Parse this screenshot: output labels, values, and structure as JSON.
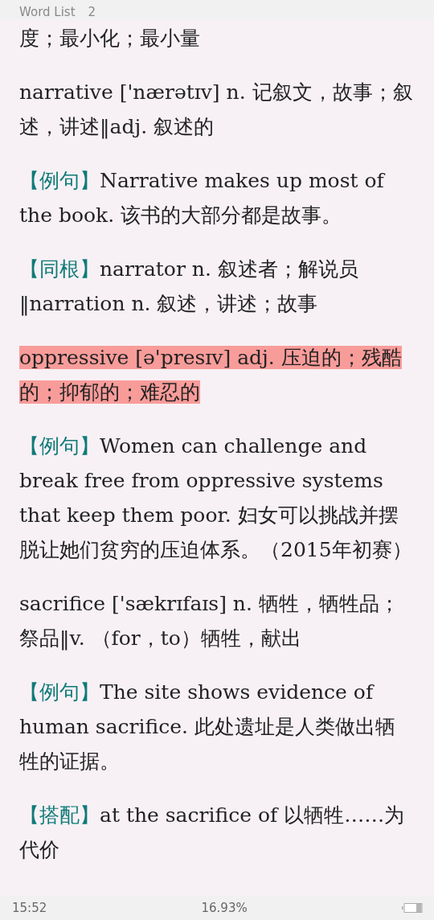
{
  "header": {
    "title": "Word List",
    "number": "2"
  },
  "paragraphs": [
    {
      "text": "度；最小化；最小量",
      "highlighted": false
    },
    {
      "text": "narrative ['nærətɪv] n. 记叙文，故事；叙述，讲述‖adj. 叙述的",
      "highlighted": false
    },
    {
      "tag": "【例句】",
      "text": "Narrative makes up most of the book. 该书的大部分都是故事。",
      "highlighted": false
    },
    {
      "tag": "【同根】",
      "text": "narrator n. 叙述者；解说员‖narration n. 叙述，讲述；故事",
      "highlighted": false
    },
    {
      "text": "oppressive [ə'presɪv] adj. 压迫的；残酷的；抑郁的；难忍的",
      "highlighted": true
    },
    {
      "tag": "【例句】",
      "text": "Women can challenge and break free from oppressive systems that keep them poor. 妇女可以挑战并摆脱让她们贫穷的压迫体系。（2015年初赛）",
      "highlighted": false
    },
    {
      "text": "sacrifice ['sækrɪfaɪs] n. 牺牲，牺牲品；祭品‖v. （for，to）牺牲，献出",
      "highlighted": false
    },
    {
      "tag": "【例句】",
      "text": "The site shows evidence of human sacrifice. 此处遗址是人类做出牺牲的证据。",
      "highlighted": false
    },
    {
      "tag": "【搭配】",
      "text": "at the sacrifice of 以牺牲……为代价",
      "highlighted": false
    }
  ],
  "status_bar": {
    "time": "15:52",
    "progress": "16.93%"
  }
}
